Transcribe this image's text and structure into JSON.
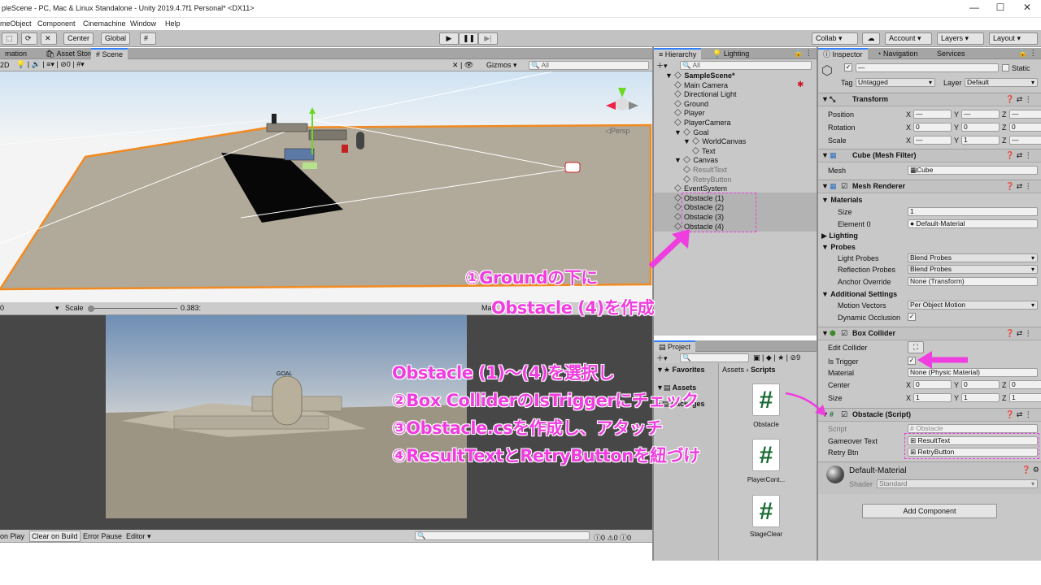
{
  "window": {
    "title": "pleScene - PC, Mac & Linux Standalone - Unity 2019.4.7f1 Personal* <DX11>",
    "minimize": "—",
    "maximize": "☐",
    "close": "✕"
  },
  "menu": [
    "meObject",
    "Component",
    "Cinemachine",
    "Window",
    "Help"
  ],
  "toolbar": {
    "center": "Center",
    "global": "Global",
    "collab": "Collab ▾",
    "account": "Account",
    "layers": "Layers",
    "layout": "Layout"
  },
  "scene": {
    "tabs": [
      "mation",
      "Asset Store",
      "Scene"
    ],
    "mode": "2D",
    "counter": "0",
    "gizmos": "Gizmos ▾",
    "search_placeholder": "All",
    "persp": "◁Persp"
  },
  "game": {
    "scale_label": "Scale",
    "scale_value": "0.383:",
    "display": "0",
    "goal_label": "GOAL",
    "maximize": "Ma"
  },
  "console": {
    "buttons": [
      "on Play",
      "Clear on Build",
      "Error Pause",
      "Editor ▾"
    ],
    "counts": [
      "0",
      "0",
      "0"
    ]
  },
  "hierarchy": {
    "tabs": [
      "Hierarchy",
      "Lighting"
    ],
    "search_placeholder": "All",
    "items": [
      {
        "label": "SampleScene*",
        "indent": 0
      },
      {
        "label": "Main Camera",
        "indent": 1
      },
      {
        "label": "Directional Light",
        "indent": 1
      },
      {
        "label": "Ground",
        "indent": 1
      },
      {
        "label": "Player",
        "indent": 1
      },
      {
        "label": "PlayerCamera",
        "indent": 1
      },
      {
        "label": "Goal",
        "indent": 1
      },
      {
        "label": "WorldCanvas",
        "indent": 2
      },
      {
        "label": "Text",
        "indent": 3
      },
      {
        "label": "Canvas",
        "indent": 1
      },
      {
        "label": "ResultText",
        "indent": 2
      },
      {
        "label": "RetryButton",
        "indent": 2
      },
      {
        "label": "EventSystem",
        "indent": 1
      },
      {
        "label": "Obstacle (1)",
        "indent": 1
      },
      {
        "label": "Obstacle (2)",
        "indent": 1
      },
      {
        "label": "Obstacle (3)",
        "indent": 1
      },
      {
        "label": "Obstacle (4)",
        "indent": 1
      }
    ]
  },
  "project": {
    "tab": "Project",
    "count": "9",
    "favorites": "Favorites",
    "assets": "Assets",
    "packages": "Packages",
    "breadcrumb_root": "Assets",
    "breadcrumb_sep": "›",
    "breadcrumb_leaf": "Scripts",
    "files": [
      "Obstacle",
      "PlayerCont...",
      "StageClear"
    ]
  },
  "inspector": {
    "tabs": [
      "Inspector",
      "Navigation",
      "Services"
    ],
    "name": "—",
    "static": "Static",
    "tag_label": "Tag",
    "tag": "Untagged",
    "layer_label": "Layer",
    "layer": "Default",
    "transform": {
      "title": "Transform",
      "position": [
        "—",
        "—",
        "—"
      ],
      "rotation": [
        "0",
        "0",
        "0"
      ],
      "scale": [
        "—",
        "1",
        "—"
      ],
      "labels": [
        "Position",
        "Rotation",
        "Scale"
      ]
    },
    "mesh_filter": {
      "title": "Cube (Mesh Filter)",
      "mesh_label": "Mesh",
      "mesh": "Cube"
    },
    "mesh_renderer": {
      "title": "Mesh Renderer",
      "materials": "Materials",
      "size_label": "Size",
      "size": "1",
      "element_label": "Element 0",
      "element": "Default-Material",
      "lighting": "Lighting",
      "probes": "Probes",
      "light_probes_label": "Light Probes",
      "light_probes": "Blend Probes",
      "reflection_label": "Reflection Probes",
      "reflection": "Blend Probes",
      "anchor_label": "Anchor Override",
      "anchor": "None (Transform)",
      "additional": "Additional Settings",
      "motion_label": "Motion Vectors",
      "motion": "Per Object Motion",
      "dynamic_label": "Dynamic Occlusion"
    },
    "box_collider": {
      "title": "Box Collider",
      "edit_label": "Edit Collider",
      "trigger_label": "Is Trigger",
      "material_label": "Material",
      "material": "None (Physic Material)",
      "center_label": "Center",
      "center": [
        "0",
        "0",
        "0"
      ],
      "size_label": "Size",
      "size": [
        "1",
        "1",
        "1"
      ]
    },
    "script": {
      "title": "Obstacle (Script)",
      "script_label": "Script",
      "script": "Obstacle",
      "gameover_label": "Gameover Text",
      "gameover": "ResultText",
      "retry_label": "Retry Btn",
      "retry": "RetryButton"
    },
    "material": {
      "name": "Default-Material",
      "shader_label": "Shader",
      "shader": "Standard"
    },
    "add_component": "Add Component"
  },
  "annotations": {
    "a1": "①Groundの下に",
    "a2": "Obstacle (4)を作成",
    "a3": "Obstacle (1)〜(4)を選択し",
    "a4": "②Box ColliderのIsTriggerにチェック",
    "a5": "③Obstacle.csを作成し、アタッチ",
    "a6": "④ResultTextとRetryButtonを紐づけ"
  },
  "colors": {
    "annotation": "#ef3ddf",
    "accent": "#2f7fff",
    "script_hash": "#1a6b33"
  }
}
